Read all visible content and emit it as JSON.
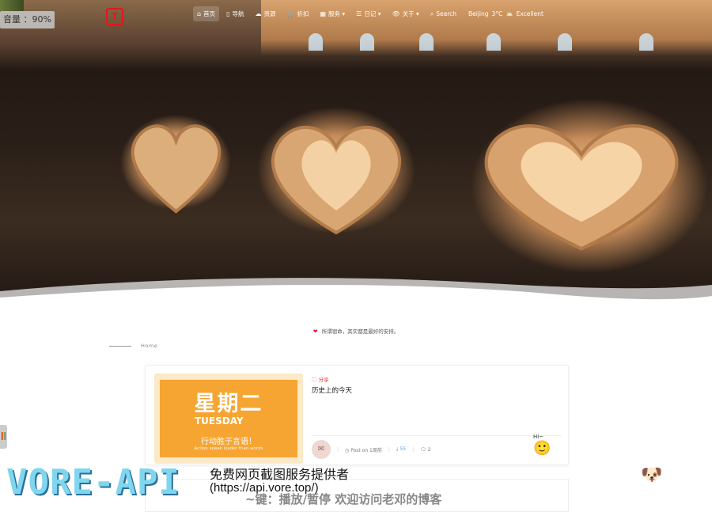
{
  "volume": {
    "label": "音量 ：90%"
  },
  "logo": {
    "letter": "T"
  },
  "nav": {
    "items": [
      {
        "icon": "home-icon",
        "glyph": "⌂",
        "label": "首页",
        "active": true
      },
      {
        "icon": "book-icon",
        "glyph": "▯",
        "label": "导航"
      },
      {
        "icon": "cloud-icon",
        "glyph": "☁",
        "label": "资源"
      },
      {
        "icon": "cart-icon",
        "glyph": "🛒",
        "label": "折扣"
      },
      {
        "icon": "grid-icon",
        "glyph": "▦",
        "label": "服务 ▾"
      },
      {
        "icon": "list-icon",
        "glyph": "☰",
        "label": "日记 ▾"
      },
      {
        "icon": "eye-icon",
        "glyph": "👁",
        "label": "关于 ▾"
      },
      {
        "icon": "search-icon",
        "glyph": "⌕",
        "label": "Search"
      }
    ],
    "weather": {
      "city": "Beijing",
      "temp": "3°C",
      "condition": "Excellent"
    }
  },
  "motto": "所谓宿命，其实都是最好的安排。",
  "breadcrumb": {
    "label": "Home"
  },
  "post": {
    "category": "分享",
    "title": "历史上的今天",
    "thumb": {
      "big": "星期二",
      "en": "TUESDAY",
      "cn": "行动胜于言语！",
      "small": "Action speak louder than words"
    },
    "meta": {
      "posted": "Post on 1周前",
      "views": "55",
      "comments": "2"
    },
    "mascot_text": "Hi~"
  },
  "overlay": {
    "brand": "VORE-API",
    "line1": "免费网页截图服务提供者",
    "line2": "(https://api.vore.top/)",
    "ticker": "~键：播放/暂停 欢迎访问老邓的博客"
  },
  "colors": {
    "accent": "#f6a532",
    "logo": "#e01818",
    "category": "#e03a3a"
  }
}
